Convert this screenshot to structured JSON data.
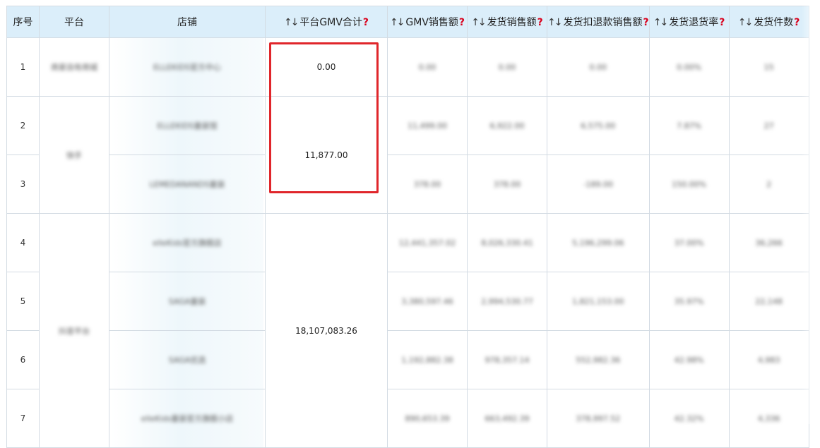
{
  "columns": {
    "index": "序号",
    "platform": "平台",
    "shop": "店铺",
    "platform_gmv": "平台GMV合计",
    "gmv_sales": "GMV销售额",
    "ship_sales": "发货销售额",
    "ship_refund_sales": "发货扣退款销售额",
    "ship_return_rate": "发货退货率",
    "ship_count": "发货件数"
  },
  "sort_glyph": "↑↓",
  "help_glyph": "?",
  "groups": [
    {
      "platform": "商家自有商城",
      "gmv_total": "0.00"
    },
    {
      "platform": "快手",
      "gmv_total": "11,877.00"
    },
    {
      "platform": "抖音平台",
      "gmv_total": "18,107,083.26"
    }
  ],
  "rows": [
    {
      "index": "1",
      "shop": "ELLEKIDS官方中心",
      "gmv": "0.00",
      "ship_sales": "0.00",
      "refund_sales": "0.00",
      "return_rate": "0.00%",
      "count": "15"
    },
    {
      "index": "2",
      "shop": "ELLEKIDS童装馆",
      "gmv": "11,499.00",
      "ship_sales": "6,922.00",
      "refund_sales": "6,575.00",
      "return_rate": "7.87%",
      "count": "27"
    },
    {
      "index": "3",
      "shop": "LEMEDANANDS童装",
      "gmv": "378.00",
      "ship_sales": "378.00",
      "refund_sales": "-189.00",
      "return_rate": "150.00%",
      "count": "2"
    },
    {
      "index": "4",
      "shop": "elleKids官方旗舰店",
      "gmv": "12,441,357.02",
      "ship_sales": "8,026,330.41",
      "refund_sales": "5,196,299.06",
      "return_rate": "37.00%",
      "count": "36,266"
    },
    {
      "index": "5",
      "shop": "SAGA童装",
      "gmv": "3,380,597.46",
      "ship_sales": "2,994,530.77",
      "refund_sales": "1,821,153.00",
      "return_rate": "35.97%",
      "count": "22,148"
    },
    {
      "index": "6",
      "shop": "SAGA优选",
      "gmv": "1,192,882.38",
      "ship_sales": "978,357.14",
      "refund_sales": "552,982.36",
      "return_rate": "42.98%",
      "count": "4,983"
    },
    {
      "index": "7",
      "shop": "elleKids童装官方旗舰小店",
      "gmv": "890,653.39",
      "ship_sales": "663,492.39",
      "refund_sales": "378,997.52",
      "return_rate": "42.32%",
      "count": "4,336"
    }
  ]
}
